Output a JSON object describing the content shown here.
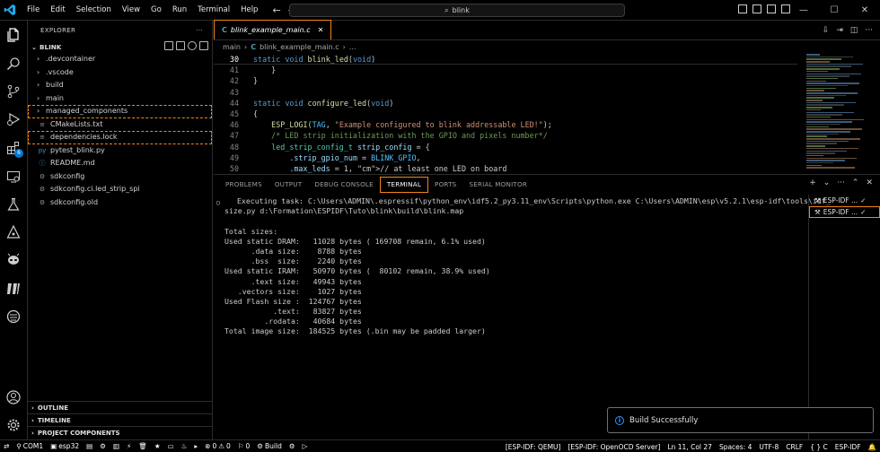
{
  "titlebar": {
    "menu": [
      "File",
      "Edit",
      "Selection",
      "View",
      "Go",
      "Run",
      "Terminal",
      "Help"
    ],
    "search": "blink",
    "back_icon": "arrow-left-icon",
    "forward_icon": "arrow-right-icon"
  },
  "activitybar": {
    "extensions_badge": "6",
    "icons": [
      "explorer-icon",
      "search-icon",
      "source-control-icon",
      "run-debug-icon",
      "extensions-icon",
      "remote-explorer-icon",
      "testing-icon",
      "esp-idf-icon",
      "alien-icon",
      "platformio-icon",
      "connections-icon",
      "account-icon",
      "gear-icon"
    ]
  },
  "sidebar": {
    "title": "EXPLORER",
    "more": "···",
    "section": "BLINK",
    "items": [
      {
        "label": ".devcontainer",
        "type": "folder"
      },
      {
        "label": ".vscode",
        "type": "folder"
      },
      {
        "label": "build",
        "type": "folder"
      },
      {
        "label": "main",
        "type": "folder"
      },
      {
        "label": "managed_components",
        "type": "folder"
      },
      {
        "label": "CMakeLists.txt",
        "type": "file",
        "icon": "≡"
      },
      {
        "label": "dependencies.lock",
        "type": "file",
        "icon": "≡"
      },
      {
        "label": "pytest_blink.py",
        "type": "file",
        "icon": "py"
      },
      {
        "label": "README.md",
        "type": "file",
        "icon": "ⓘ"
      },
      {
        "label": "sdkconfig",
        "type": "file",
        "icon": "⚙"
      },
      {
        "label": "sdkconfig.ci.led_strip_spi",
        "type": "file",
        "icon": "⚙"
      },
      {
        "label": "sdkconfig.old",
        "type": "file",
        "icon": "⚙"
      }
    ],
    "bottom_sections": [
      "OUTLINE",
      "TIMELINE",
      "PROJECT COMPONENTS"
    ]
  },
  "editor": {
    "tab": "blink_example_main.c",
    "tab_icon": "C",
    "breadcrumb": [
      "main",
      "blink_example_main.c",
      "..."
    ],
    "lines": [
      {
        "n": "30",
        "code": "static void blink_led(void)"
      },
      {
        "n": "41",
        "code": "    }"
      },
      {
        "n": "42",
        "code": "}"
      },
      {
        "n": "43",
        "code": ""
      },
      {
        "n": "44",
        "code": "static void configure_led(void)"
      },
      {
        "n": "45",
        "code": "{"
      },
      {
        "n": "46",
        "code": "    ESP_LOGI(TAG, \"Example configured to blink addressable LED!\");"
      },
      {
        "n": "47",
        "code": "    /* LED strip initialization with the GPIO and pixels number*/"
      },
      {
        "n": "48",
        "code": "    led_strip_config_t strip_config = {"
      },
      {
        "n": "49",
        "code": "        .strip_gpio_num = BLINK_GPIO,"
      },
      {
        "n": "50",
        "code": "        .max_leds = 1, // at least one LED on board"
      }
    ]
  },
  "panel": {
    "tabs": [
      "PROBLEMS",
      "OUTPUT",
      "DEBUG CONSOLE",
      "TERMINAL",
      "PORTS",
      "SERIAL MONITOR"
    ],
    "active_tab": "TERMINAL",
    "terminal_lines": [
      "Executing task: C:\\Users\\ADMIN\\.espressif\\python_env\\idf5.2_py3.11_env\\Scripts\\python.exe C:\\Users\\ADMIN\\esp\\v5.2.1\\esp-idf\\tools\\idf_",
      "size.py d:\\Formation\\ESPIDF\\Tuto\\blink\\build\\blink.map",
      "",
      "Total sizes:",
      "Used static DRAM:   11028 bytes ( 169708 remain, 6.1% used)",
      "      .data size:    8788 bytes",
      "      .bss  size:    2240 bytes",
      "Used static IRAM:   50970 bytes (  80102 remain, 38.9% used)",
      "      .text size:   49943 bytes",
      "   .vectors size:    1027 bytes",
      "Used Flash size :  124767 bytes",
      "           .text:   83827 bytes",
      "         .rodata:   40684 bytes",
      "Total image size:  184525 bytes (.bin may be padded larger)"
    ],
    "terminals": [
      {
        "label": "ESP-IDF ...",
        "check": "✓"
      },
      {
        "label": "ESP-IDF ...",
        "check": "✓"
      }
    ]
  },
  "notification": {
    "text": "Build Successfully"
  },
  "statusbar": {
    "left": [
      "COM1",
      "esp32",
      "⚙",
      "🗑",
      "★",
      "Build"
    ],
    "port": "COM1",
    "target": "esp32",
    "errors": "0",
    "warnings": "0",
    "info": "0",
    "build": "Build",
    "right": [
      "[ESP-IDF: QEMU]",
      "[ESP-IDF: OpenOCD Server]",
      "Ln 11, Col 27",
      "Spaces: 4",
      "UTF-8",
      "CRLF",
      "{ } C",
      "ESP-IDF"
    ]
  }
}
